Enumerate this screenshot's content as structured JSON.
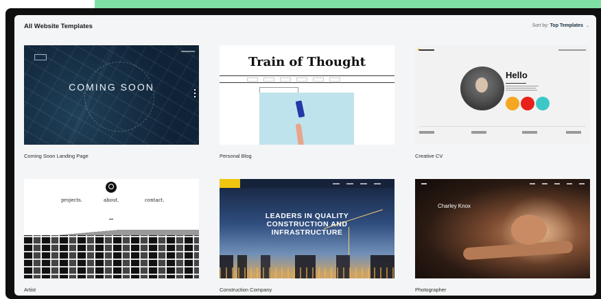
{
  "header": {
    "title": "All Website Templates",
    "sort_label": "Sort by:",
    "sort_value": "Top Templates"
  },
  "icons": {
    "sort_dropdown": "chevron-down-icon"
  },
  "colors": {
    "accent_bar": "#7ee0a5",
    "frame": "#0f0f0f",
    "panel": "#f4f5f6"
  },
  "templates": [
    {
      "name": "Coming Soon Landing Page",
      "preview": {
        "headline": "COMING SOON"
      }
    },
    {
      "name": "Personal Blog",
      "preview": {
        "headline": "Train of Thought"
      }
    },
    {
      "name": "Creative CV",
      "preview": {
        "headline": "Hello"
      }
    },
    {
      "name": "Artist",
      "preview": {
        "nav": [
          "projects.",
          "about.",
          "contact."
        ]
      }
    },
    {
      "name": "Construction Company",
      "preview": {
        "headline_lines": [
          "LEADERS IN QUALITY",
          "CONSTRUCTION AND",
          "INFRASTRUCTURE"
        ]
      }
    },
    {
      "name": "Photographer",
      "preview": {
        "headline": "Charley Knox"
      }
    }
  ]
}
